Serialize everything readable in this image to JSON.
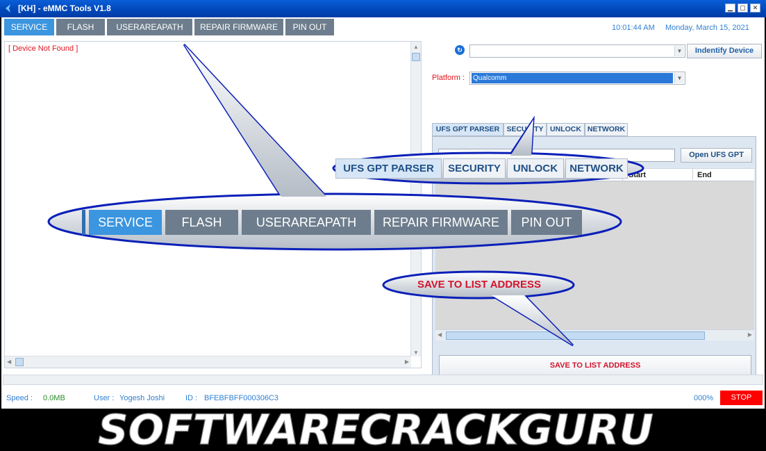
{
  "window": {
    "title": "[KH] - eMMC Tools V1.8",
    "controls": {
      "minimize": "▁",
      "maximize": "▢",
      "close": "✕"
    }
  },
  "menu": [
    {
      "label": "SERVICE",
      "active": true
    },
    {
      "label": "FLASH",
      "active": false
    },
    {
      "label": "USERAREAPATH",
      "active": false
    },
    {
      "label": "REPAIR FIRMWARE",
      "active": false
    },
    {
      "label": "PIN OUT",
      "active": false
    }
  ],
  "clock": {
    "time": "10:01:44 AM",
    "date": "Monday, March 15, 2021"
  },
  "log": {
    "message": "[ Device Not Found ]"
  },
  "device": {
    "value": "",
    "identify_label": "Indentify Device"
  },
  "platform": {
    "label": "Platform :",
    "value": "Qualcomm"
  },
  "tabs": [
    {
      "label": "UFS GPT PARSER",
      "active": true
    },
    {
      "label": "SECURITY",
      "active": false
    },
    {
      "label": "UNLOCK",
      "active": false
    },
    {
      "label": "NETWORK",
      "active": false
    }
  ],
  "ufs": {
    "open_label": "Open UFS GPT",
    "columns": [
      "Start",
      "End"
    ],
    "save_label": "SAVE TO LIST ADDRESS"
  },
  "status": {
    "speed_label": "Speed :",
    "speed_value": "0.0MB",
    "user_label": "User :",
    "user_value": "Yogesh Joshi",
    "id_label": "ID :",
    "id_value": "BFEBFBFF000306C3",
    "percent": "000%",
    "stop_label": "STOP"
  },
  "callouts": {
    "menu": [
      "SERVICE",
      "FLASH",
      "USERAREAPATH",
      "REPAIR FIRMWARE",
      "PIN OUT"
    ],
    "tabs": [
      "UFS GPT PARSER",
      "SECURITY",
      "UNLOCK",
      "NETWORK"
    ],
    "save": "SAVE TO LIST ADDRESS"
  },
  "watermark": "SOFTWARECRACKGURU",
  "colors": {
    "accent": "#3b95df",
    "menu_bg": "#6d7d8d",
    "error_red": "#e0141e",
    "stop_red": "#ff0000",
    "callout_stroke": "#0a1fb8"
  }
}
